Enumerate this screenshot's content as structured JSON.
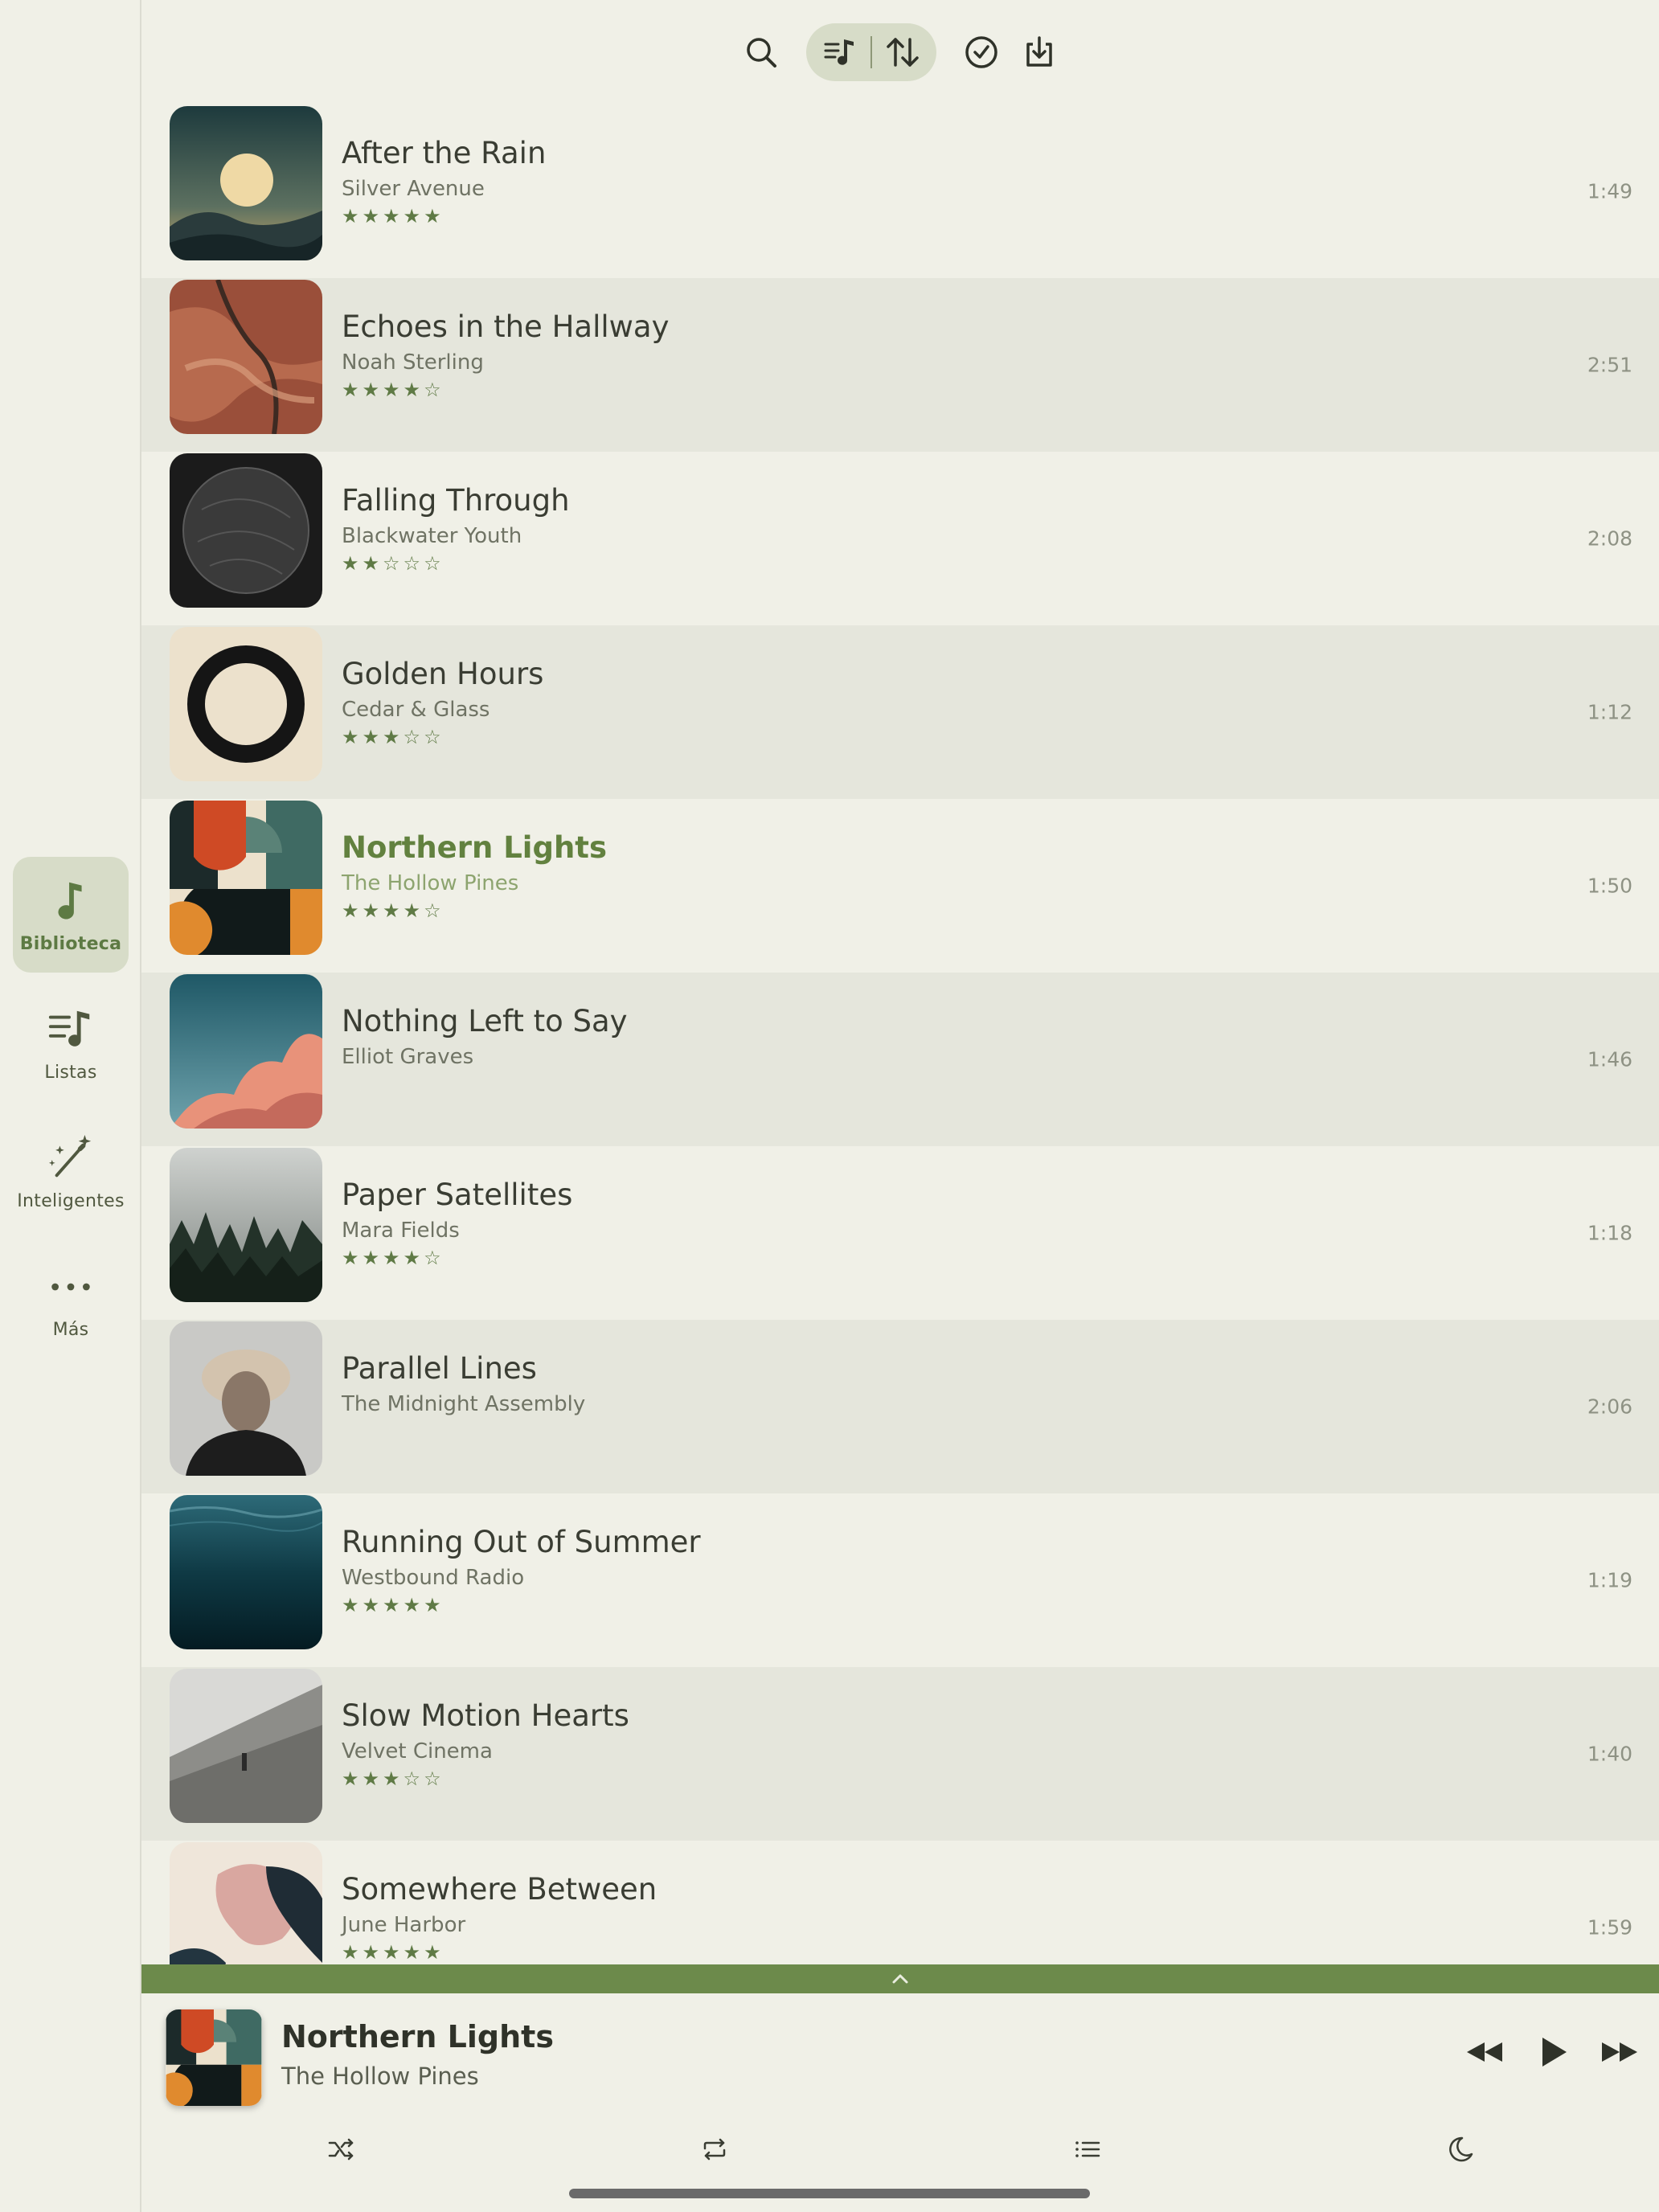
{
  "colors": {
    "accent": "#62813f",
    "background": "#f0f0e7",
    "row_alt": "#e5e6dc",
    "active_nav": "#d7dcc8",
    "player_bar": "#6c8a4b"
  },
  "sidebar": {
    "items": [
      {
        "label": "Biblioteca",
        "icon": "music-note-icon",
        "active": true
      },
      {
        "label": "Listas",
        "icon": "playlist-icon",
        "active": false
      },
      {
        "label": "Inteligentes",
        "icon": "magic-wand-icon",
        "active": false
      },
      {
        "label": "Más",
        "icon": "more-dots-icon",
        "active": false
      }
    ]
  },
  "toolbar": {
    "icons": [
      "search-icon",
      "playlist-filter-icon",
      "sort-icon",
      "select-check-icon",
      "download-icon"
    ]
  },
  "songs": [
    {
      "title": "After the Rain",
      "artist": "Silver Avenue",
      "rating": 5,
      "stars": "★★★★★",
      "duration": "1:49"
    },
    {
      "title": "Echoes in the Hallway",
      "artist": "Noah Sterling",
      "rating": 4,
      "stars": "★★★★☆",
      "duration": "2:51"
    },
    {
      "title": "Falling Through",
      "artist": "Blackwater Youth",
      "rating": 2,
      "stars": "★★☆☆☆",
      "duration": "2:08"
    },
    {
      "title": "Golden Hours",
      "artist": "Cedar & Glass",
      "rating": 3,
      "stars": "★★★☆☆",
      "duration": "1:12"
    },
    {
      "title": "Northern Lights",
      "artist": "The Hollow Pines",
      "rating": 4,
      "stars": "★★★★☆",
      "duration": "1:50",
      "playing": true
    },
    {
      "title": "Nothing Left to Say",
      "artist": "Elliot Graves",
      "rating": 0,
      "stars": "",
      "duration": "1:46"
    },
    {
      "title": "Paper Satellites",
      "artist": "Mara Fields",
      "rating": 4,
      "stars": "★★★★☆",
      "duration": "1:18"
    },
    {
      "title": "Parallel Lines",
      "artist": "The Midnight Assembly",
      "rating": 0,
      "stars": "",
      "duration": "2:06"
    },
    {
      "title": "Running Out of Summer",
      "artist": "Westbound Radio",
      "rating": 5,
      "stars": "★★★★★",
      "duration": "1:19"
    },
    {
      "title": "Slow Motion Hearts",
      "artist": "Velvet Cinema",
      "rating": 3,
      "stars": "★★★☆☆",
      "duration": "1:40"
    },
    {
      "title": "Somewhere Between",
      "artist": "June Harbor",
      "rating": 5,
      "stars": "★★★★★",
      "duration": "1:59"
    }
  ],
  "now_playing": {
    "title": "Northern Lights",
    "artist": "The Hollow Pines",
    "controls": [
      "rewind-icon",
      "play-icon",
      "fast-forward-icon"
    ],
    "secondary": [
      "shuffle-icon",
      "repeat-icon",
      "queue-list-icon",
      "sleep-timer-moon-icon"
    ]
  }
}
